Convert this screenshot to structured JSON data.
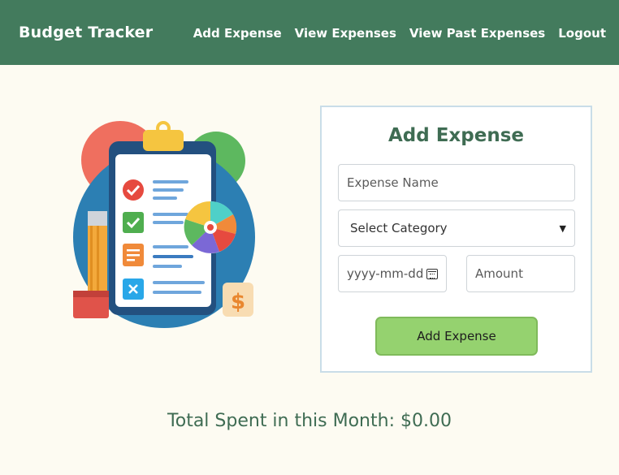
{
  "nav": {
    "brand": "Budget Tracker",
    "links": [
      "Add Expense",
      "View Expenses",
      "View Past Expenses",
      "Logout"
    ]
  },
  "form": {
    "title": "Add Expense",
    "name_placeholder": "Expense Name",
    "category_selected": "Select Category",
    "date_placeholder": "yyyy-mm-dd",
    "amount_placeholder": "Amount",
    "submit_label": "Add Expense"
  },
  "summary": {
    "total_label": "Total Spent in this Month:",
    "total_value": "$0.00"
  },
  "colors": {
    "navbar": "#437b5d",
    "accent_green": "#95d26f",
    "title_green": "#3f6c53",
    "background": "#fdfbf2"
  },
  "icons": [
    "calendar-icon",
    "chevron-down-icon",
    "checklist-illustration"
  ]
}
